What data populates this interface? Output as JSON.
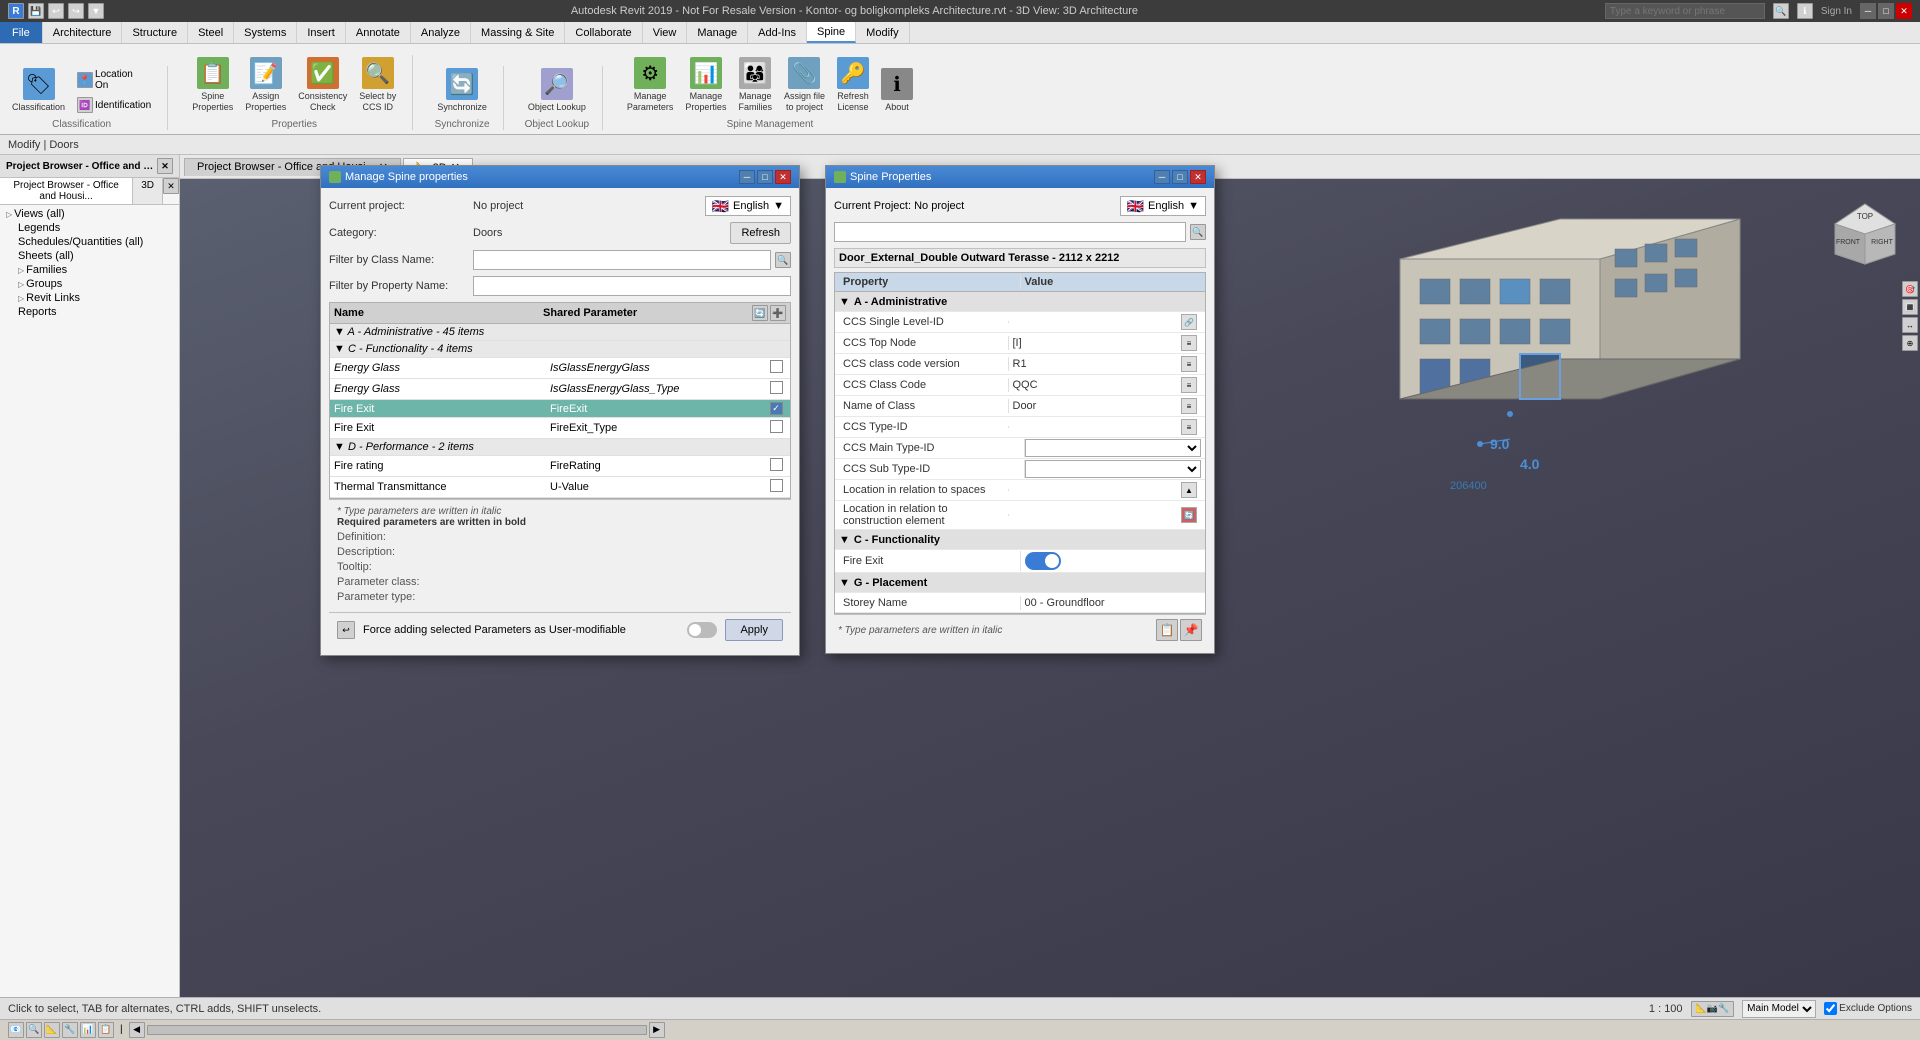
{
  "titlebar": {
    "title": "Autodesk Revit 2019 - Not For Resale Version - Kontor- og boligkompleks Architecture.rvt - 3D View: 3D Architecture",
    "search_placeholder": "Type a keyword or phrase",
    "sign_in": "Sign In",
    "minimize": "─",
    "maximize": "□",
    "close": "✕"
  },
  "ribbon": {
    "tabs": [
      "File",
      "Architecture",
      "Structure",
      "Steel",
      "Systems",
      "Insert",
      "Annotate",
      "Analyze",
      "Massing & Site",
      "Collaborate",
      "View",
      "Manage",
      "Add-Ins",
      "Spine",
      "Modify"
    ],
    "active_tab": "Spine",
    "groups": {
      "classification": {
        "label": "Classification",
        "items": [
          {
            "label": "Classification",
            "icon": "classify-icon"
          },
          {
            "label": "Identification",
            "icon": "id-icon"
          }
        ]
      },
      "properties": {
        "label": "Properties",
        "items": [
          {
            "label": "Spine\nProperties",
            "icon": "spine-prop-icon"
          },
          {
            "label": "Assign\nProperties",
            "icon": "assign-prop-icon"
          },
          {
            "label": "Consistency\nCheck",
            "icon": "consist-icon"
          },
          {
            "label": "Select by\nCCS ID",
            "icon": "select-icon"
          }
        ]
      },
      "spine_mgmt": {
        "label": "Spine Management",
        "items": [
          {
            "label": "Manage\nParameters",
            "icon": "manage-params-icon"
          },
          {
            "label": "Manage\nProperties",
            "icon": "manage-props-icon"
          },
          {
            "label": "Manage\nFamilies",
            "icon": "manage-fam-icon"
          },
          {
            "label": "Assign file\nto project",
            "icon": "assign-file-icon"
          },
          {
            "label": "Refresh\nLicense",
            "icon": "refresh-lic-icon"
          },
          {
            "label": "About",
            "icon": "about-icon"
          }
        ]
      }
    }
  },
  "modify_bar": {
    "text": "Modify | Doors"
  },
  "project_browser": {
    "title": "Project Browser - Office and Housi...",
    "active_tab": "3D",
    "tabs": [
      "3D"
    ],
    "tree": [
      {
        "label": "Views (all)",
        "indent": 0,
        "arrow": "▷",
        "icon": "📁"
      },
      {
        "label": "Legends",
        "indent": 1,
        "icon": "📋"
      },
      {
        "label": "Schedules/Quantities (all)",
        "indent": 1,
        "icon": "📋"
      },
      {
        "label": "Sheets (all)",
        "indent": 1,
        "icon": "📄"
      },
      {
        "label": "Families",
        "indent": 1,
        "icon": "📁"
      },
      {
        "label": "Groups",
        "indent": 1,
        "icon": "📁"
      },
      {
        "label": "Revit Links",
        "indent": 1,
        "icon": "🔗"
      },
      {
        "label": "Reports",
        "indent": 1,
        "icon": "📊"
      }
    ]
  },
  "canvas": {
    "tabs": [
      {
        "label": "Project Browser - Office and Housi...",
        "active": false
      },
      {
        "label": "3D",
        "active": true
      }
    ]
  },
  "dialog_manage": {
    "title": "Manage Spine properties",
    "current_project_label": "Current project:",
    "current_project_value": "No project",
    "language_label": "English",
    "refresh_label": "Refresh",
    "category_label": "Category:",
    "category_value": "Doors",
    "filter_class_label": "Filter by Class Name:",
    "filter_property_label": "Filter by Property Name:",
    "table": {
      "col_name": "Name",
      "col_param": "Shared Parameter",
      "rows": [
        {
          "type": "section",
          "name": "A - Administrative - 45 items",
          "param": ""
        },
        {
          "type": "section",
          "name": "C - Functionality - 4 items",
          "param": ""
        },
        {
          "type": "data",
          "name": "Energy Glass",
          "param": "IsGlassEnergyGlass",
          "checked": false,
          "italic": true
        },
        {
          "type": "data",
          "name": "Energy Glass",
          "param": "IsGlassEnergyGlass_Type",
          "checked": false,
          "italic": true
        },
        {
          "type": "data",
          "name": "Fire Exit",
          "param": "FireExit",
          "checked": true,
          "selected": true
        },
        {
          "type": "data",
          "name": "Fire Exit",
          "param": "FireExit_Type",
          "checked": false
        },
        {
          "type": "section",
          "name": "D - Performance - 2 items",
          "param": ""
        },
        {
          "type": "data",
          "name": "Fire rating",
          "param": "FireRating",
          "checked": false
        },
        {
          "type": "data",
          "name": "Thermal Transmittance",
          "param": "U-Value",
          "checked": false
        }
      ]
    },
    "italic_note": "* Type parameters are written in italic",
    "bold_note": "Required parameters are written in bold",
    "fields": [
      {
        "label": "Definition:",
        "value": ""
      },
      {
        "label": "Description:",
        "value": ""
      },
      {
        "label": "Tooltip:",
        "value": ""
      },
      {
        "label": "Parameter class:",
        "value": ""
      },
      {
        "label": "Parameter type:",
        "value": ""
      }
    ],
    "force_label": "Force adding selected Parameters as User-modifiable",
    "apply_label": "Apply",
    "refresh_icon": "↻"
  },
  "dialog_spine": {
    "title": "Spine Properties",
    "current_project_label": "Current Project: No project",
    "language_label": "English",
    "door_title": "Door_External_Double Outward Terasse - 2112 x 2212",
    "table": {
      "col_property": "Property",
      "col_value": "Value",
      "sections": [
        {
          "name": "A - Administrative",
          "rows": [
            {
              "property": "CCS Single Level-ID",
              "value": "",
              "action": "link"
            },
            {
              "property": "CCS Top Node",
              "value": "[I]",
              "action": "list"
            },
            {
              "property": "CCS class code version",
              "value": "R1",
              "action": "list"
            },
            {
              "property": "CCS Class Code",
              "value": "QQC",
              "action": "list"
            },
            {
              "property": "Name of Class",
              "value": "Door",
              "action": "list"
            },
            {
              "property": "CCS Type-ID",
              "value": "",
              "action": "list"
            },
            {
              "property": "CCS Main Type-ID",
              "value": "",
              "action": "dropdown"
            },
            {
              "property": "CCS Sub Type-ID",
              "value": "",
              "action": "dropdown"
            },
            {
              "property": "Location in relation to spaces",
              "value": "",
              "action": "triangle"
            },
            {
              "property": "Location in relation to construction element",
              "value": "",
              "action": "refresh"
            }
          ]
        },
        {
          "name": "C - Functionality",
          "rows": [
            {
              "property": "Fire Exit",
              "value": "toggle_on",
              "action": "none"
            }
          ]
        },
        {
          "name": "G - Placement",
          "rows": [
            {
              "property": "Storey Name",
              "value": "00 - Groundfloor",
              "action": "none"
            }
          ]
        }
      ]
    },
    "italic_note": "* Type parameters are written in italic",
    "bottom_buttons": [
      "copy",
      "paste"
    ]
  },
  "statusbar": {
    "left": "Click to select, TAB for alternates, CTRL adds, SHIFT unselects.",
    "scale": "1 : 100",
    "main_model": "Main Model",
    "exclude_options": "Exclude Options"
  }
}
